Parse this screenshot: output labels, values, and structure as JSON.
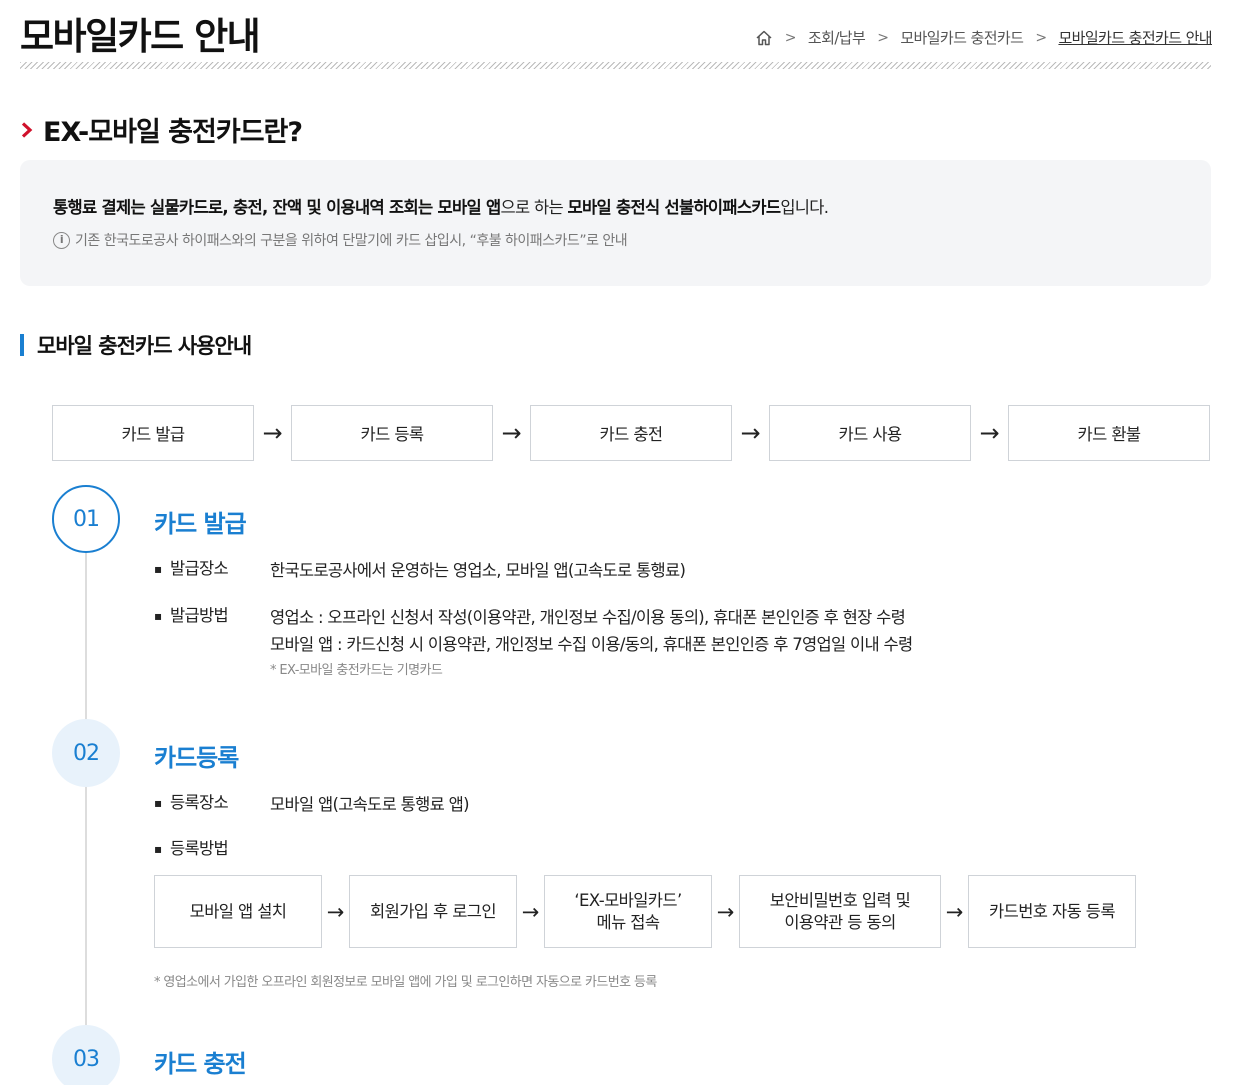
{
  "header": {
    "title": "모바일카드 안내",
    "breadcrumb": [
      "조회/납부",
      "모바일카드 충전카드",
      "모바일카드 충전카드 안내"
    ]
  },
  "intro": {
    "title": "EX-모바일 충전카드란?",
    "main_b1": "통행료 결제는 실물카드로, 충전, 잔액 및 이용내역 조회는 모바일 앱",
    "main_t1": "으로 하는 ",
    "main_b2": "모바일 충전식 선불하이패스카드",
    "main_t2": "입니다.",
    "note": "기존 한국도로공사 하이패스와의 구분을 위하여 단말기에 카드 삽입시, “후불 하이패스카드”로 안내"
  },
  "usage": {
    "title": "모바일 충전카드 사용안내",
    "flow": [
      "카드 발급",
      "카드 등록",
      "카드 충전",
      "카드 사용",
      "카드 환불"
    ]
  },
  "steps": [
    {
      "num": "01",
      "title": "카드 발급",
      "items": [
        {
          "label": "발급장소",
          "desc": "한국도로공사에서 운영하는 영업소, 모바일 앱(고속도로 통행료)"
        },
        {
          "label": "발급방법",
          "desc1": "영업소 : 오프라인 신청서 작성(이용약관, 개인정보 수집/이용 동의), 휴대폰 본인인증 후 현장 수령",
          "desc2": "모바일 앱 : 카드신청 시 이용약관, 개인정보 수집 이용/동의, 휴대폰 본인인증 후 7영업일 이내 수령",
          "note": "* EX-모바일 충전카드는 기명카드"
        }
      ]
    },
    {
      "num": "02",
      "title": "카드등록",
      "items": [
        {
          "label": "등록장소",
          "desc": "모바일 앱(고속도로 통행료 앱)"
        },
        {
          "label": "등록방법"
        }
      ],
      "flow": [
        "모바일 앱 설치",
        "회원가입 후 로그인",
        "‘EX-모바일카드’\n메뉴 접속",
        "보안비밀번호 입력 및\n이용약관 등 동의",
        "카드번호 자동 등록"
      ],
      "note": "* 영업소에서 가입한 오프라인 회원정보로 모바일 앱에 가입 및 로그인하면 자동으로 카드번호 등록"
    },
    {
      "num": "03",
      "title": "카드 충전"
    }
  ],
  "colors": {
    "accent": "#1a7fd1",
    "chevron": "#d0112b"
  }
}
